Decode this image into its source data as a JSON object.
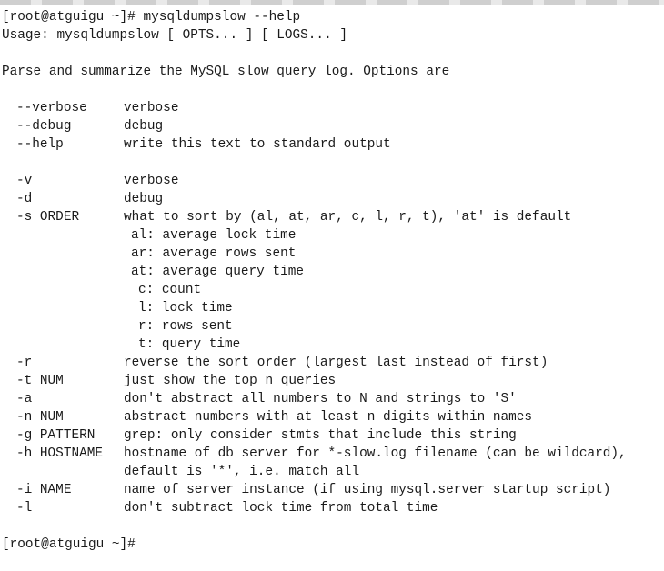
{
  "terminal": {
    "command_line": "[root@atguigu ~]# mysqldumpslow --help",
    "usage": "Usage: mysqldumpslow [ OPTS... ] [ LOGS... ]",
    "summary": "Parse and summarize the MySQL slow query log. Options are",
    "options_group1": [
      {
        "flag": "--verbose",
        "desc": "verbose"
      },
      {
        "flag": "--debug",
        "desc": "debug"
      },
      {
        "flag": "--help",
        "desc": "write this text to standard output"
      }
    ],
    "opt_v": {
      "flag": "-v",
      "desc": "verbose"
    },
    "opt_d": {
      "flag": "-d",
      "desc": "debug"
    },
    "opt_s": {
      "flag": "-s ORDER",
      "desc": "what to sort by (al, at, ar, c, l, r, t), 'at' is default"
    },
    "sort_orders": [
      "al: average lock time",
      "ar: average rows sent",
      "at: average query time",
      "c: count",
      "l: lock time",
      "r: rows sent",
      "t: query time"
    ],
    "opt_r": {
      "flag": "-r",
      "desc": "reverse the sort order (largest last instead of first)"
    },
    "opt_t": {
      "flag": "-t NUM",
      "desc": "just show the top n queries"
    },
    "opt_a": {
      "flag": "-a",
      "desc": "don't abstract all numbers to N and strings to 'S'"
    },
    "opt_n": {
      "flag": "-n NUM",
      "desc": "abstract numbers with at least n digits within names"
    },
    "opt_g": {
      "flag": "-g PATTERN",
      "desc": "grep: only consider stmts that include this string"
    },
    "opt_h": {
      "flag": "-h HOSTNAME",
      "desc": "hostname of db server for *-slow.log filename (can be wildcard),",
      "desc_cont": "default is '*', i.e. match all"
    },
    "opt_i": {
      "flag": "-i NAME",
      "desc": "name of server instance (if using mysql.server startup script)"
    },
    "opt_l": {
      "flag": "-l",
      "desc": "don't subtract lock time from total time"
    },
    "prompt": "[root@atguigu ~]#"
  }
}
